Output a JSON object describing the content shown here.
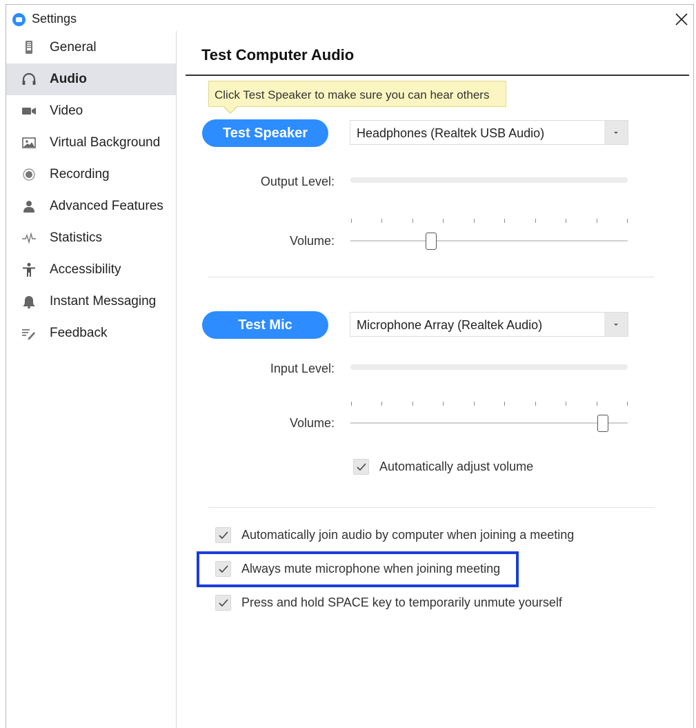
{
  "window": {
    "title": "Settings"
  },
  "sidebar": {
    "items": [
      {
        "label": "General",
        "icon": "phone-icon",
        "active": false
      },
      {
        "label": "Audio",
        "icon": "headphones-icon",
        "active": true
      },
      {
        "label": "Video",
        "icon": "video-camera-icon",
        "active": false
      },
      {
        "label": "Virtual Background",
        "icon": "picture-icon",
        "active": false
      },
      {
        "label": "Recording",
        "icon": "record-icon",
        "active": false
      },
      {
        "label": "Advanced Features",
        "icon": "person-icon",
        "active": false
      },
      {
        "label": "Statistics",
        "icon": "pulse-icon",
        "active": false
      },
      {
        "label": "Accessibility",
        "icon": "accessibility-icon",
        "active": false
      },
      {
        "label": "Instant Messaging",
        "icon": "bell-icon",
        "active": false
      },
      {
        "label": "Feedback",
        "icon": "feedback-icon",
        "active": false
      }
    ]
  },
  "main": {
    "title": "Test Computer Audio",
    "tooltip": "Click Test Speaker to make sure you can hear others",
    "speaker": {
      "button_label": "Test Speaker",
      "device": "Headphones (Realtek USB Audio)",
      "output_level_label": "Output Level:",
      "volume_label": "Volume:",
      "volume_fraction": 0.29
    },
    "mic": {
      "button_label": "Test Mic",
      "device": "Microphone Array (Realtek Audio)",
      "input_level_label": "Input Level:",
      "volume_label": "Volume:",
      "volume_fraction": 0.91,
      "auto_adjust_label": "Automatically adjust volume",
      "auto_adjust_checked": true
    },
    "options": [
      {
        "label": "Automatically join audio by computer when joining a meeting",
        "checked": true
      },
      {
        "label": "Always mute microphone when joining meeting",
        "checked": true
      },
      {
        "label": "Press and hold SPACE key to temporarily unmute yourself",
        "checked": true
      }
    ]
  },
  "colors": {
    "accent": "#2d8cff",
    "highlight": "#1a3ed8",
    "tooltip_bg": "#fbf6c1",
    "sidebar_active": "#e1e3e8"
  }
}
